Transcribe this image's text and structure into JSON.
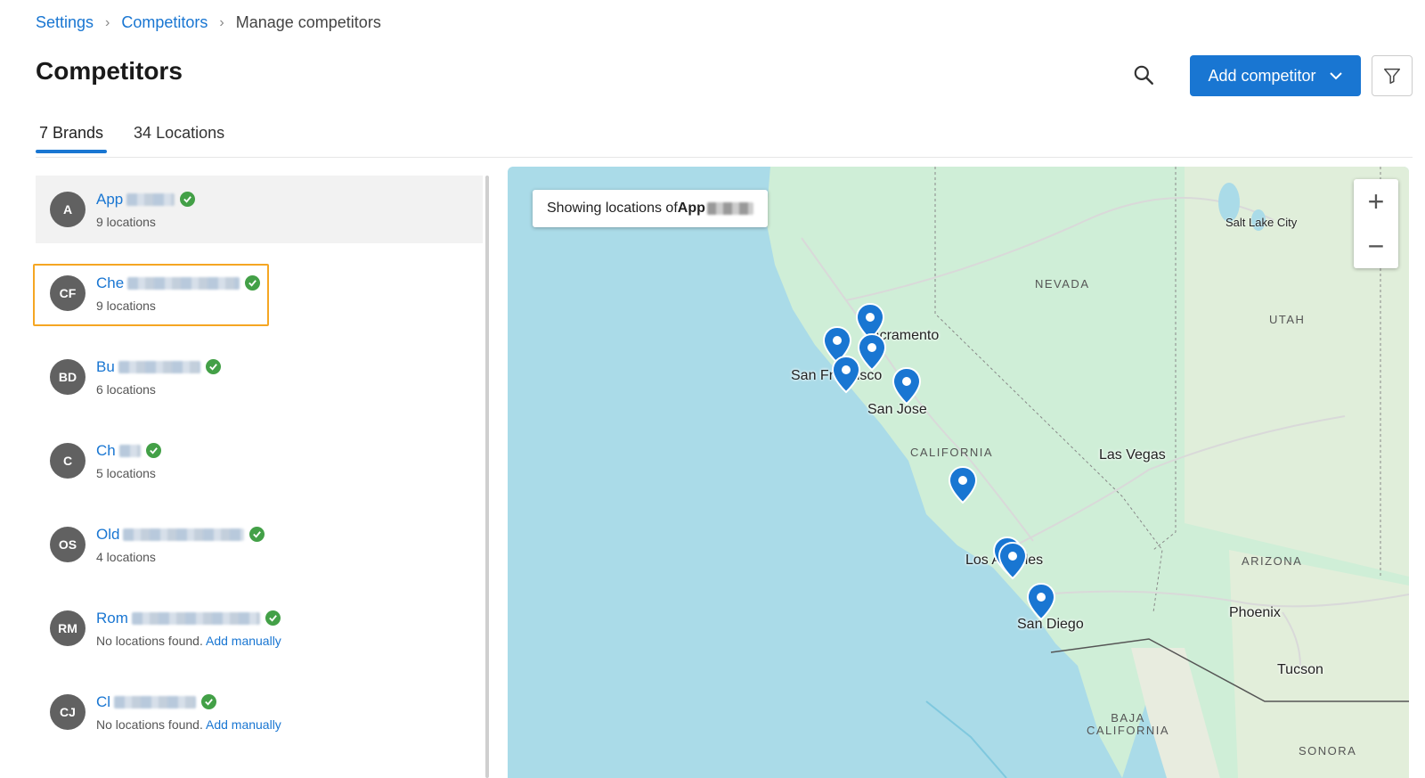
{
  "breadcrumb": {
    "items": [
      "Settings",
      "Competitors"
    ],
    "current": "Manage competitors"
  },
  "page": {
    "title": "Competitors"
  },
  "toolbar": {
    "add_label": "Add competitor"
  },
  "tabs": [
    {
      "label": "7 Brands",
      "active": true
    },
    {
      "label": "34 Locations",
      "active": false
    }
  ],
  "brands": [
    {
      "initials": "A",
      "name": "App",
      "sub": "9 locations"
    },
    {
      "initials": "CF",
      "name": "Che",
      "sub": "9 locations"
    },
    {
      "initials": "BD",
      "name": "Bu",
      "sub": "6 locations"
    },
    {
      "initials": "C",
      "name": "Ch",
      "sub": "5 locations"
    },
    {
      "initials": "OS",
      "name": "Old",
      "sub": "4 locations"
    },
    {
      "initials": "RM",
      "name": "Rom",
      "sub": "No locations found.",
      "link": "Add manually"
    },
    {
      "initials": "CJ",
      "name": "Cl",
      "sub": "No locations found.",
      "link": "Add manually"
    }
  ],
  "map": {
    "tooltip_prefix": "Showing locations of ",
    "tooltip_brand": "App",
    "labels": {
      "salt_lake": "Salt Lake City",
      "nevada": "NEVADA",
      "utah": "UTAH",
      "sacramento": "Sacramento",
      "san_francisco": "San Francisco",
      "san_jose": "San Jose",
      "california": "CALIFORNIA",
      "las_vegas": "Las Vegas",
      "los_angeles": "Los Angeles",
      "arizona": "ARIZONA",
      "phoenix": "Phoenix",
      "san_diego": "San Diego",
      "tucson": "Tucson",
      "baja": "BAJA\nCALIFORNIA",
      "sonora": "SONORA"
    },
    "zoom_in": "+",
    "zoom_out": "−"
  },
  "colors": {
    "accent": "#1976d2",
    "check": "#43a047",
    "highlight": "#f5a623",
    "water": "#aadbe8",
    "land": "#c9ecd2"
  }
}
